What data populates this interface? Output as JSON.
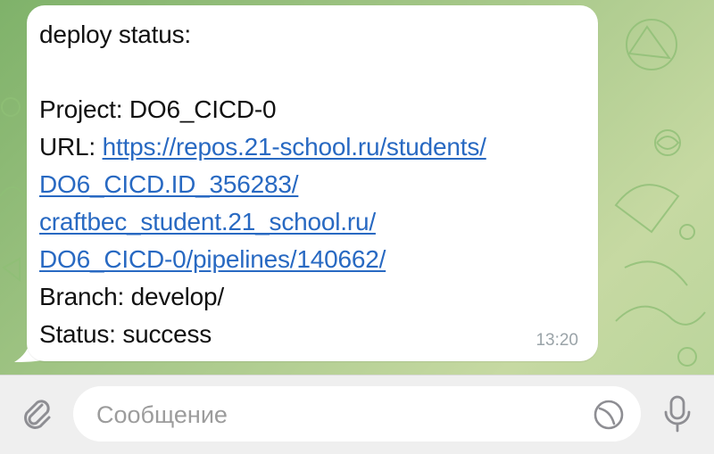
{
  "message": {
    "header": "deploy status:",
    "project_label": "Project: DO6_CICD-0",
    "url_label": "URL: ",
    "url_lines": [
      "https://repos.21-school.ru/students/",
      "DO6_CICD.ID_356283/",
      "craftbec_student.21_school.ru/",
      "DO6_CICD-0/pipelines/140662/"
    ],
    "branch_label": "Branch: develop/",
    "status_label": "Status: success",
    "time": "13:20"
  },
  "composer": {
    "placeholder": "Сообщение",
    "icons": {
      "attach": "paperclip-icon",
      "sticker": "sticker-icon",
      "mic": "microphone-icon"
    }
  },
  "colors": {
    "link": "#2869c2",
    "bubble": "#ffffff",
    "timestamp": "#9aa3a8",
    "composer_bg": "#efefef"
  }
}
